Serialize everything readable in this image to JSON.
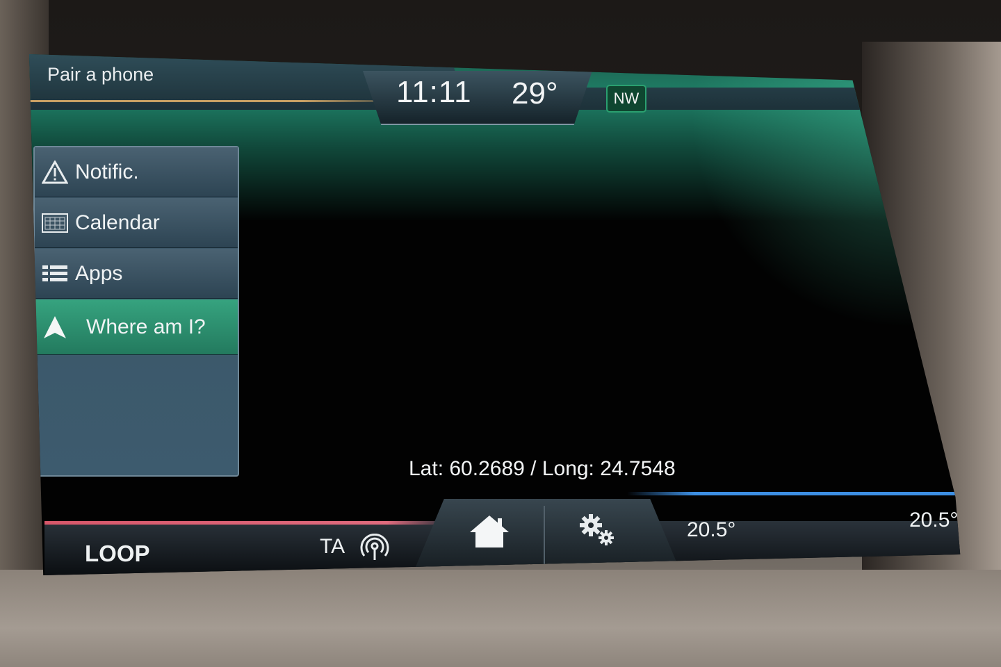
{
  "header": {
    "phone_label": "Pair a phone",
    "time": "11:11",
    "outside_temp": "29°",
    "compass_heading": "NW"
  },
  "sidebar": {
    "items": [
      {
        "label": "Notific.",
        "icon": "warning-icon",
        "active": false
      },
      {
        "label": "Calendar",
        "icon": "calendar-icon",
        "active": false
      },
      {
        "label": "Apps",
        "icon": "apps-grid-icon",
        "active": false
      },
      {
        "label": "Where am I?",
        "icon": "navigation-arrow-icon",
        "active": true
      }
    ]
  },
  "main": {
    "coordinates": "Lat: 60.2689 / Long: 24.7548"
  },
  "footer": {
    "source_label": "LOOP",
    "traffic_announce_label": "TA",
    "temp_driver": "20.5°",
    "temp_passenger": "20.5°"
  },
  "colors": {
    "accent_green": "#237a5e",
    "audio_line": "#d8576a",
    "climate_line": "#3d8fe3"
  }
}
